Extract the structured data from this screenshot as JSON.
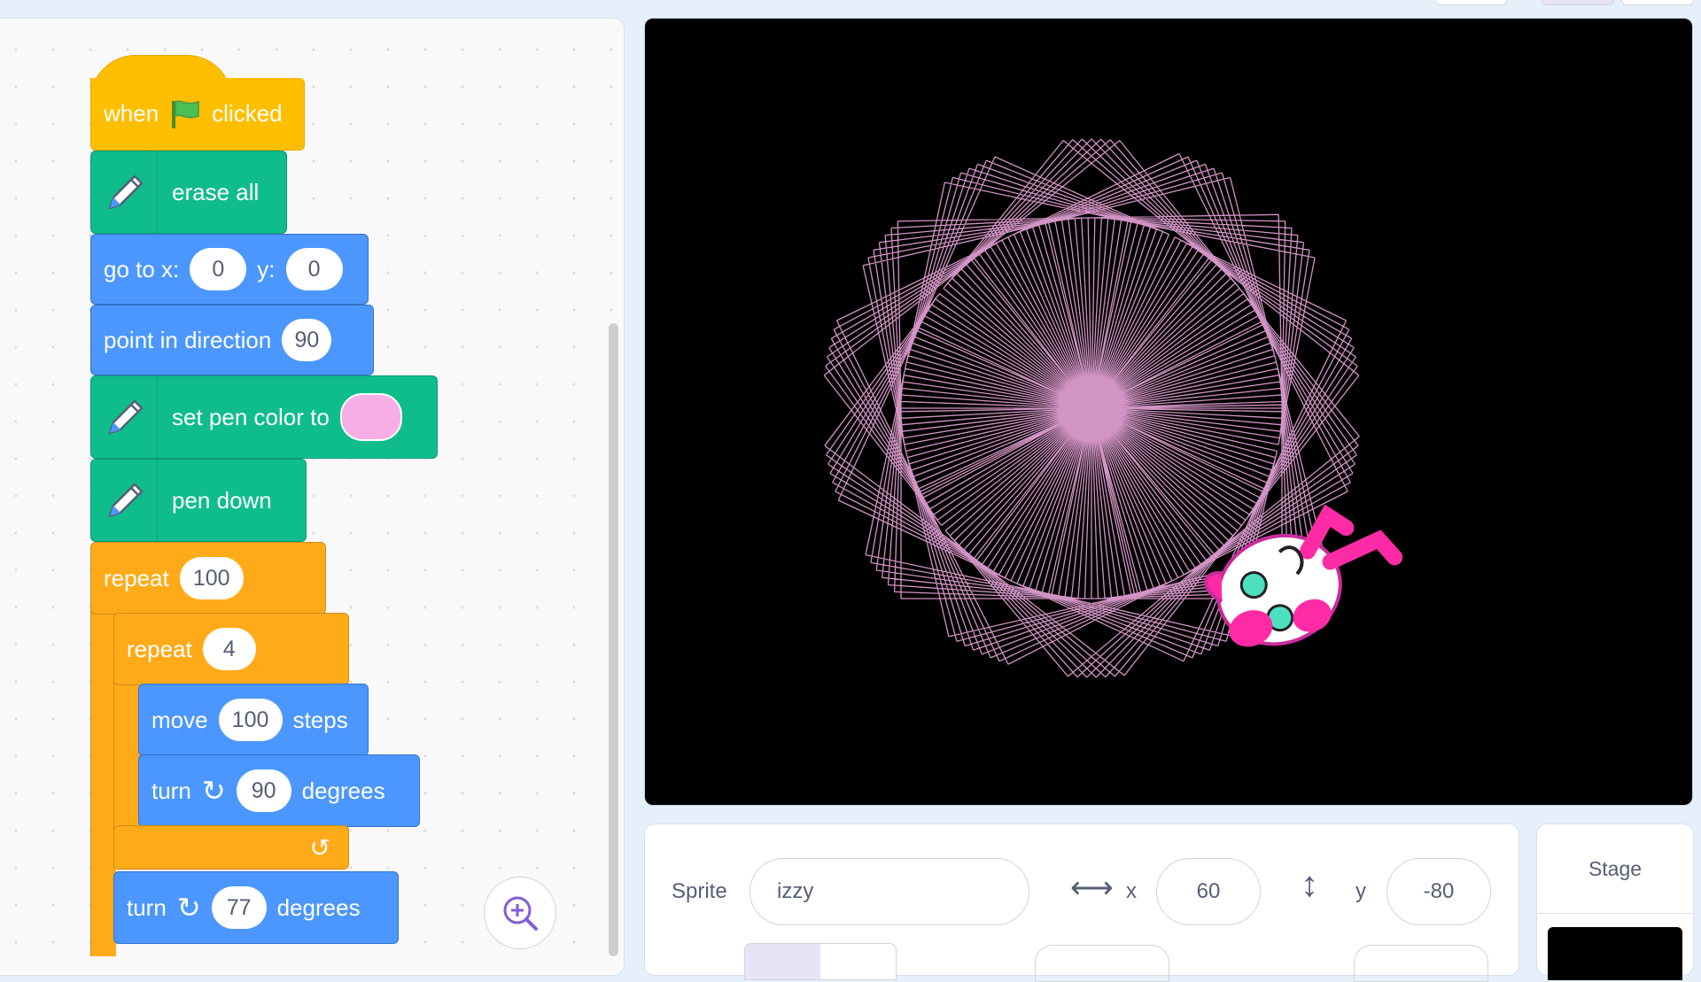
{
  "blocks": {
    "hat": {
      "when": "when",
      "clicked": "clicked"
    },
    "erase_all": "erase all",
    "go_to": {
      "label": "go to x:",
      "x": "0",
      "y_label": "y:",
      "y": "0"
    },
    "point_direction": {
      "label": "point in direction",
      "value": "90"
    },
    "set_pen_color": {
      "label": "set pen color to",
      "color": "#f7aee6"
    },
    "pen_down": "pen down",
    "repeat_outer": {
      "label": "repeat",
      "count": "100"
    },
    "repeat_inner": {
      "label": "repeat",
      "count": "4"
    },
    "move": {
      "label": "move",
      "value": "100",
      "unit": "steps"
    },
    "turn_inner": {
      "label": "turn",
      "value": "90",
      "unit": "degrees"
    },
    "turn_outer": {
      "label": "turn",
      "value": "77",
      "unit": "degrees"
    }
  },
  "sprite_info": {
    "sprite_label": "Sprite",
    "sprite_name": "izzy",
    "x_label": "x",
    "x_value": "60",
    "y_label": "y",
    "y_value": "-80"
  },
  "stage_panel": {
    "label": "Stage"
  },
  "colors": {
    "pen": "#f7aee6",
    "stage_bg": "#000000"
  }
}
